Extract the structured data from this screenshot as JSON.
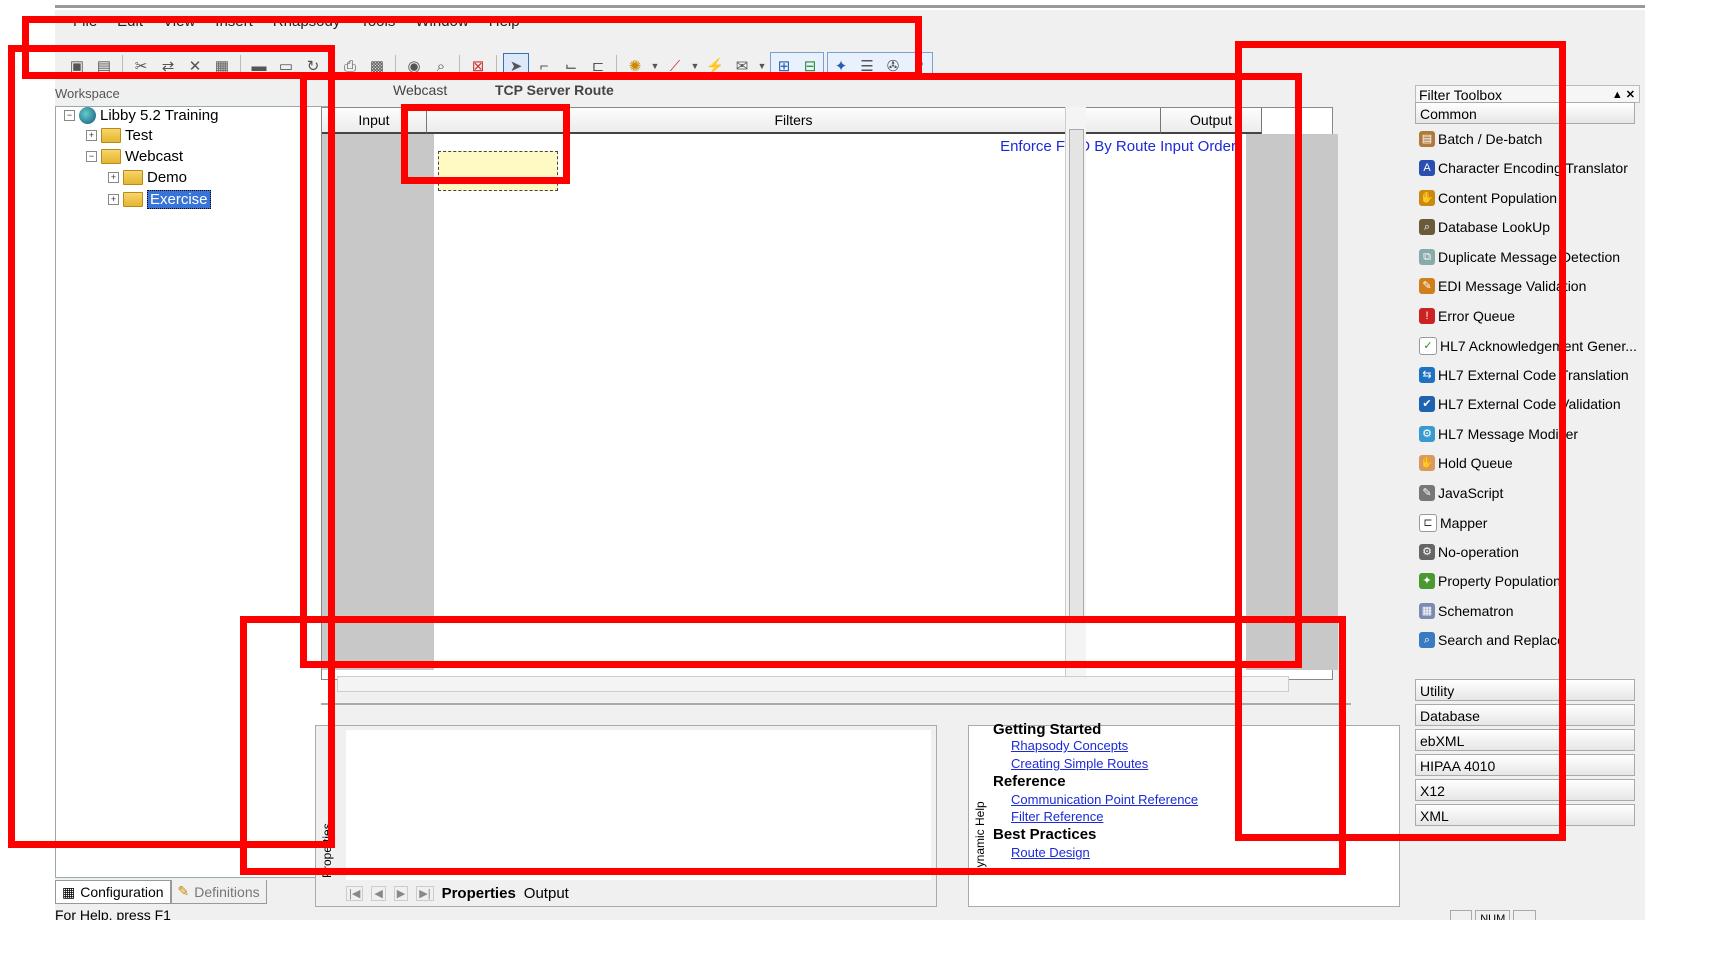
{
  "menu": [
    "File",
    "Edit",
    "View",
    "Insert",
    "Rhapsody",
    "Tools",
    "Window",
    "Help"
  ],
  "tab_strip": {
    "left": "Webcast",
    "active": "TCP Server Route"
  },
  "workspace": {
    "title": "Workspace",
    "tree": {
      "root": "Libby 5.2 Training",
      "test": "Test",
      "webcast": "Webcast",
      "demo": "Demo",
      "exercise": "Exercise"
    },
    "tabs": {
      "configuration": "Configuration",
      "definitions": "Definitions"
    }
  },
  "route": {
    "headers": {
      "input": "Input",
      "filters": "Filters",
      "output": "Output"
    },
    "enforce_label": "Enforce FIFO By Route Input Order"
  },
  "properties": {
    "side_label": "Properties",
    "tabs": {
      "properties": "Properties",
      "output": "Output"
    }
  },
  "help": {
    "side_label": "Dynamic Help",
    "getting_started": "Getting Started",
    "links1": [
      "Rhapsody Concepts",
      "Creating Simple Routes"
    ],
    "reference": "Reference",
    "links2": [
      "Communication Point Reference",
      "Filter Reference"
    ],
    "best_practices": "Best Practices",
    "links3": [
      "Route Design"
    ]
  },
  "toolbox": {
    "title": "Filter Toolbox",
    "common": "Common",
    "items": [
      "Batch / De-batch",
      "Character Encoding Translator",
      "Content Population",
      "Database LookUp",
      "Duplicate Message Detection",
      "EDI Message Validation",
      "Error Queue",
      "HL7 Acknowledgement Gener...",
      "HL7 External Code Translation",
      "HL7 External Code Validation",
      "HL7 Message Modifier",
      "Hold Queue",
      "JavaScript",
      "Mapper",
      "No-operation",
      "Property Population",
      "Schematron",
      "Search and Replace"
    ],
    "categories": [
      "Utility",
      "Database",
      "ebXML",
      "HIPAA 4010",
      "X12",
      "XML"
    ]
  },
  "status": {
    "help": "For Help, press F1",
    "num": "NUM"
  },
  "colors": {
    "annotation": "#ff0000",
    "selection": "#3874d8",
    "link": "#1b2ad8",
    "placeholder": "#fff9c4"
  }
}
